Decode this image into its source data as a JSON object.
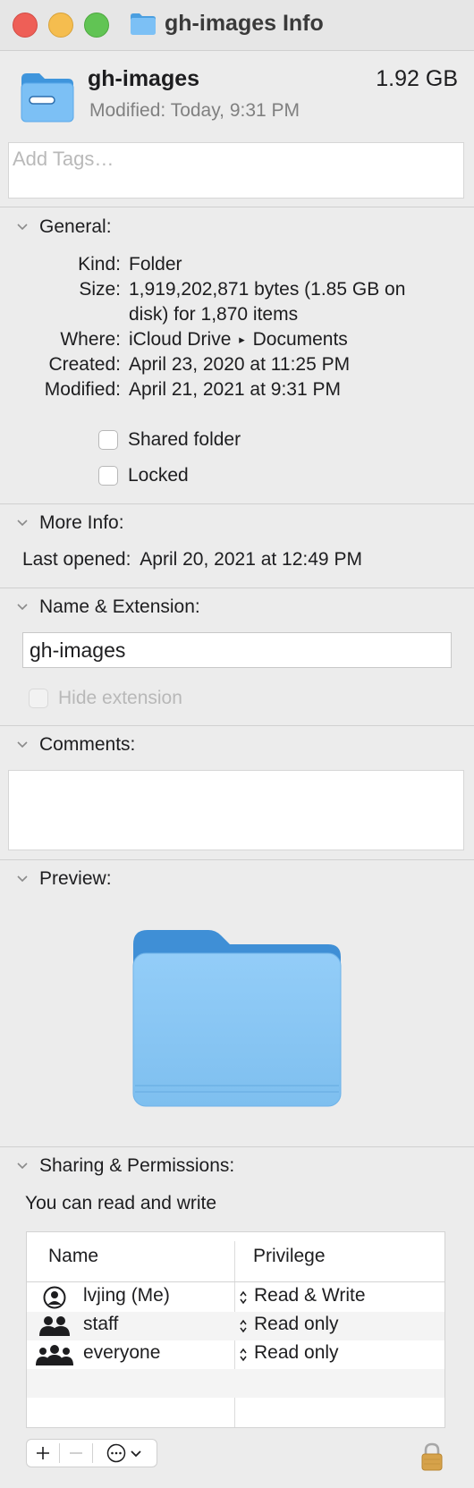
{
  "window": {
    "title": "gh-images Info"
  },
  "header": {
    "name": "gh-images",
    "size": "1.92 GB",
    "modified_label": "Modified:",
    "modified_value": "Today, 9:31 PM",
    "icon": "folder-icon"
  },
  "tags": {
    "placeholder": "Add Tags…",
    "value": ""
  },
  "general": {
    "title": "General:",
    "kind_label": "Kind:",
    "kind_value": "Folder",
    "size_label": "Size:",
    "size_value_line1": "1,919,202,871 bytes (1.85 GB on",
    "size_value_line2": "disk) for 1,870 items",
    "where_label": "Where:",
    "where_part1": "iCloud Drive",
    "where_arrow": "▸",
    "where_part2": "Documents",
    "created_label": "Created:",
    "created_value": "April 23, 2020 at 11:25 PM",
    "modified_label": "Modified:",
    "modified_value": "April 21, 2021 at 9:31 PM",
    "shared_folder_label": "Shared folder",
    "shared_folder_checked": false,
    "locked_label": "Locked",
    "locked_checked": false
  },
  "more_info": {
    "title": "More Info:",
    "last_opened_label": "Last opened:",
    "last_opened_value": "April 20, 2021 at 12:49 PM"
  },
  "name_extension": {
    "title": "Name & Extension:",
    "name_value": "gh-images",
    "hide_extension_label": "Hide extension",
    "hide_extension_enabled": false
  },
  "comments": {
    "title": "Comments:",
    "value": ""
  },
  "preview": {
    "title": "Preview:",
    "icon": "folder-icon"
  },
  "sharing": {
    "title": "Sharing & Permissions:",
    "summary": "You can read and write",
    "col_name": "Name",
    "col_privilege": "Privilege",
    "rows": [
      {
        "name": "lvjing (Me)",
        "privilege": "Read & Write",
        "icon": "user-icon"
      },
      {
        "name": "staff",
        "privilege": "Read only",
        "icon": "group-icon"
      },
      {
        "name": "everyone",
        "privilege": "Read only",
        "icon": "everyone-icon"
      }
    ]
  },
  "toolbar": {
    "add_icon": "plus-icon",
    "remove_icon": "minus-icon",
    "action_icon": "ellipsis-circle-icon",
    "lock_icon": "lock-icon"
  },
  "colors": {
    "close": "#ee5f57",
    "minimize": "#f5bd4f",
    "maximize": "#61c454",
    "folder_light": "#8ccbf7",
    "folder_dark": "#4b9fe0"
  }
}
